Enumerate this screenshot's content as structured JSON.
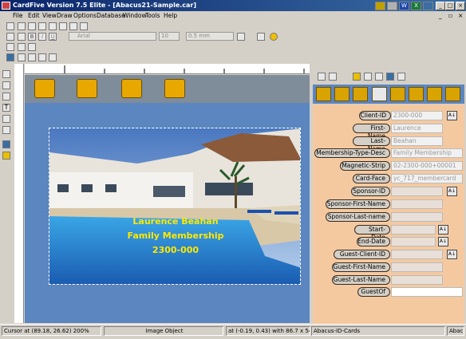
{
  "window": {
    "title": "CardFive Version 7.5 Elite - [Abacus21-Sample.car]"
  },
  "menu": [
    "File",
    "Edit",
    "View",
    "Draw",
    "Options",
    "Database",
    "Window",
    "Tools",
    "Help"
  ],
  "toolbar": {
    "font": "Arial",
    "size": "10",
    "line_width": "0.5 mm"
  },
  "card": {
    "line1": "Laurence Beahan",
    "line2": "Family Membership",
    "line3": "2300-000"
  },
  "fields": [
    {
      "label": "Client-ID",
      "value": "2300-000",
      "picker": true
    },
    {
      "label": "First-Name",
      "value": "Laurence",
      "picker": false
    },
    {
      "label": "Last-Name",
      "value": "Beahan",
      "picker": false
    },
    {
      "label": "Membership-Type-Desc",
      "value": "Family Membership",
      "picker": false
    },
    {
      "label": "Magnetic-Strip",
      "value": "02-2300-000+00001",
      "picker": false
    },
    {
      "label": "Card-Face",
      "value": "yc_717_membercard",
      "picker": false
    },
    {
      "label": "Sponsor-ID",
      "value": "",
      "picker": true
    },
    {
      "label": "Sponsor-First-Name",
      "value": "",
      "picker": false
    },
    {
      "label": "Sponsor-Last-name",
      "value": "",
      "picker": false
    },
    {
      "label": "Start-Date",
      "value": "",
      "picker": true
    },
    {
      "label": "End-Date",
      "value": "",
      "picker": true
    },
    {
      "label": "Guest-Client-ID",
      "value": "",
      "picker": true
    },
    {
      "label": "Guest-First-Name",
      "value": "",
      "picker": false
    },
    {
      "label": "Guest-Last-Name",
      "value": "",
      "picker": false
    },
    {
      "label": "GuestOf",
      "value": "",
      "picker": false
    }
  ],
  "status": {
    "cursor": "Cursor at (89.18, 26.62) 200%",
    "object": "Image Object",
    "position": "at (-0.19, 0.43) with 86.7 x 54.25 mr",
    "database": "Abacus-ID-Cards",
    "extra": "Abacu"
  },
  "colors": {
    "accent": "#0a246a",
    "canvas": "#5b86c0",
    "panel": "#f5c9a0",
    "card_text": "#ffe800"
  }
}
